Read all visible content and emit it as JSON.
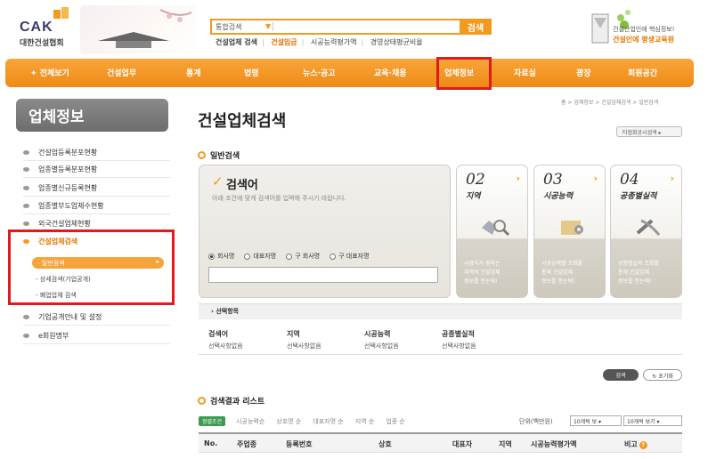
{
  "header": {
    "logo_text": "CAK",
    "logo_sub": "대한건설협회",
    "search_scope": "통합검색",
    "search_button": "검색",
    "quick_links": [
      "건설업체 검색",
      "건설임금",
      "시공능력평가액",
      "경영상태평균비율"
    ],
    "banner_line1": "건설산업인에 핵심정보!",
    "banner_line2": "건설인에 평생교육원"
  },
  "nav": {
    "items": [
      "전체보기",
      "건설업무",
      "통계",
      "법령",
      "뉴스·공고",
      "교육·채용",
      "업체정보",
      "자료실",
      "광장",
      "회원공간"
    ],
    "active": "업체정보"
  },
  "sidebar": {
    "title": "업체정보",
    "items": [
      "건설업등록분포현황",
      "업종별등록분포현황",
      "업종별신규등록현황",
      "업종별부도업체수현황",
      "외국건설업체현황",
      "건설업체검색",
      "기업공개안내 및 설정",
      "e회원명부"
    ],
    "active_item": "건설업체검색",
    "sub_items": [
      "일반검색",
      "상세검색(기업공개)",
      "폐업업체 검색"
    ],
    "active_sub": "일반검색"
  },
  "main": {
    "title": "건설업체검색",
    "breadcrumb": "홈 > 업체정보 > 건설업체검색 > 일반검색",
    "print_button": "타협회공시검색",
    "general_search_heading": "일반검색",
    "keyword_label": "검색어",
    "keyword_hint": "아래 조건에 맞게 검색어를 입력해 주시기 바랍니다.",
    "radio_options": [
      "회사명",
      "대표자명",
      "구 회사명",
      "구 대표자명"
    ],
    "radio_selected": 0,
    "keyword_value": "",
    "cards": [
      {
        "num": "02",
        "title": "지역",
        "desc": [
          "사용자가 원하는",
          "지역의 건설업체",
          "정보를 한눈에!"
        ]
      },
      {
        "num": "03",
        "title": "시공능력",
        "desc": [
          "시공능력별 조회를",
          "통해 건설업체",
          "정보를 한눈에!"
        ]
      },
      {
        "num": "04",
        "title": "공종별실적",
        "desc": [
          "공종별실적 조회를",
          "통해 건설업체",
          "정보를 한눈에!"
        ]
      }
    ],
    "selection_heading": "선택항목",
    "selection_cols": [
      {
        "label": "검색어",
        "value": "선택사항없음"
      },
      {
        "label": "지역",
        "value": "선택사항없음"
      },
      {
        "label": "시공능력",
        "value": "선택사항없음"
      },
      {
        "label": "공종별실적",
        "value": "선택사항없음"
      }
    ],
    "search_button": "검색",
    "reset_button": "초기화",
    "results_heading": "검색결과 리스트",
    "sort_badge": "정렬조건",
    "sort_options": [
      "시공능력순",
      "상호명 순",
      "대표자명 순",
      "지역 순",
      "업종 순"
    ],
    "unit_label": "단위(백만원)",
    "page_size_1": "10개씩 보",
    "page_size_2": "10개씩 보기",
    "table_headers": [
      "No.",
      "주업종",
      "등록번호",
      "상호",
      "대표자",
      "지역",
      "시공능력평가액",
      "비고"
    ]
  },
  "colors": {
    "accent": "#f29a1f",
    "highlight": "#e01b1b",
    "sidebar_title": "#7a7a7a"
  }
}
